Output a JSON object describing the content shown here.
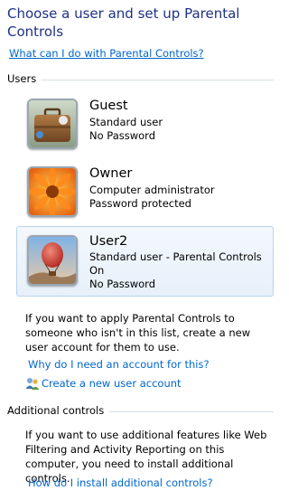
{
  "page": {
    "title": "Choose a user and set up Parental Controls",
    "help_link": "What can I do with Parental Controls?"
  },
  "users_section": {
    "heading": "Users",
    "users": [
      {
        "name": "Guest",
        "lines": [
          "Standard user",
          "No Password"
        ],
        "avatar_icon": "suitcase-icon"
      },
      {
        "name": "Owner",
        "lines": [
          "Computer administrator",
          "Password protected"
        ],
        "avatar_icon": "flower-icon"
      },
      {
        "name": "User2",
        "lines": [
          "Standard user - Parental Controls",
          "On",
          "No Password"
        ],
        "avatar_icon": "balloon-icon",
        "selected": true
      }
    ],
    "info_text": "If you want to apply Parental Controls to someone who isn't in this list, create a new user account for them to use.",
    "why_link": "Why do I need an account for this?",
    "create_link": "Create a new user account",
    "create_icon": "users-icon"
  },
  "additional_section": {
    "heading": "Additional controls",
    "info_text": "If you want to use additional features like Web Filtering and Activity Reporting on this computer, you need to install additional controls.",
    "install_link": "How do I install additional controls?"
  },
  "colors": {
    "title": "#1e3287",
    "link": "#0066cc",
    "selection_border": "#b9d4ec"
  }
}
